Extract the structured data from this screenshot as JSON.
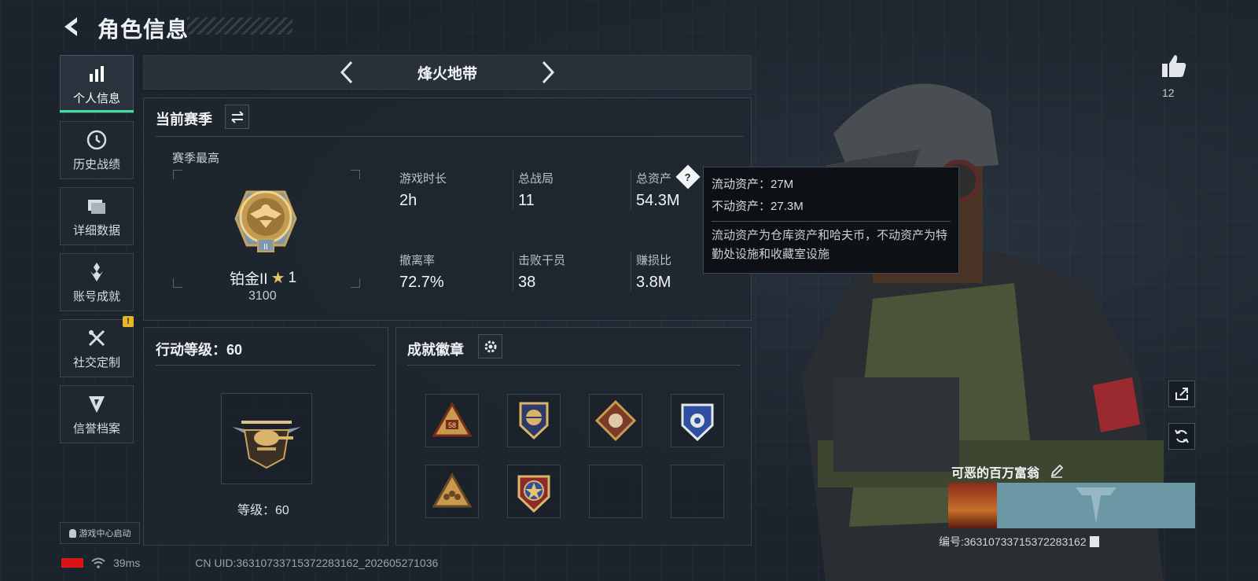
{
  "header": {
    "title": "角色信息"
  },
  "sidebar": {
    "items": [
      {
        "label": "个人信息",
        "icon": "bar-chart-icon",
        "active": true
      },
      {
        "label": "历史战绩",
        "icon": "clock-history-icon"
      },
      {
        "label": "详细数据",
        "icon": "folder-icon"
      },
      {
        "label": "账号成就",
        "icon": "achievement-icon"
      },
      {
        "label": "社交定制",
        "icon": "tools-icon",
        "badge": "!"
      },
      {
        "label": "信誉档案",
        "icon": "shield-icon"
      }
    ],
    "game_center": "游戏中心启动"
  },
  "mode": {
    "title": "烽火地带"
  },
  "season": {
    "title": "当前赛季",
    "best_label": "赛季最高",
    "rank_name": "铂金II",
    "rank_stars": "1",
    "rank_points": "3100",
    "stats": [
      {
        "label": "游戏时长",
        "value": "2h"
      },
      {
        "label": "总战局",
        "value": "11"
      },
      {
        "label": "总资产",
        "value": "54.3M"
      },
      {
        "label": "撤离率",
        "value": "72.7%"
      },
      {
        "label": "击败干员",
        "value": "38"
      },
      {
        "label": "赚损比",
        "value": "3.8M"
      }
    ]
  },
  "tooltip": {
    "liquid": "流动资产：27M",
    "fixed": "不动资产：27.3M",
    "desc": "流动资产为仓库资产和哈夫币，不动资产为特勤处设施和收藏室设施"
  },
  "action_level": {
    "title": "行动等级：60",
    "level_text": "等级：60"
  },
  "achievements": {
    "title": "成就徽章",
    "badges": [
      "triangle-58-badge",
      "wings-shield-badge",
      "diamond-beast-badge",
      "blue-shield-badge",
      "triangle-squad-badge",
      "star-shield-badge",
      "empty",
      "empty"
    ]
  },
  "profile": {
    "likes": "12",
    "name": "可恶的百万富翁",
    "id_text": "编号:3631073371537228316​2"
  },
  "status": {
    "ping": "39ms",
    "uid": "CN UID:36310733715372283162_202605271036"
  },
  "colors": {
    "accent": "#3fe0a0",
    "warning": "#e9b62b",
    "card": "#6c98a6"
  }
}
